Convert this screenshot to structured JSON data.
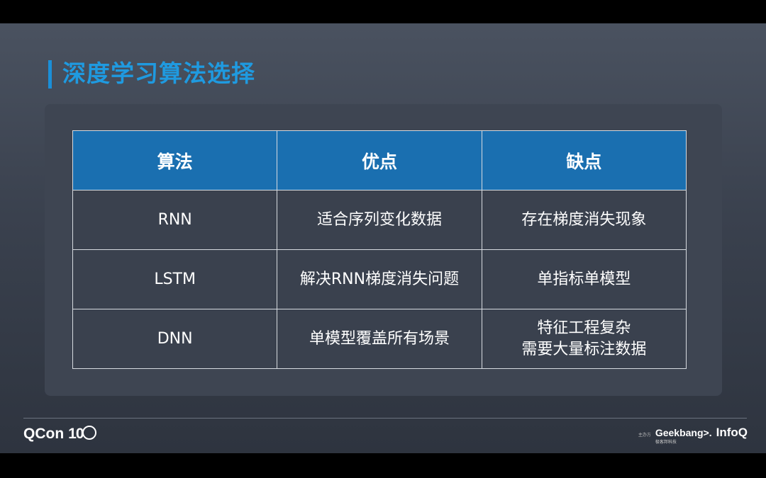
{
  "slide": {
    "title": "深度学习算法选择",
    "table": {
      "headers": [
        "算法",
        "优点",
        "缺点"
      ],
      "rows": [
        {
          "algo": "RNN",
          "pros": "适合序列变化数据",
          "cons": [
            "存在梯度消失现象"
          ]
        },
        {
          "algo": "LSTM",
          "pros": "解决RNN梯度消失问题",
          "cons": [
            "单指标单模型"
          ]
        },
        {
          "algo": "DNN",
          "pros": "单模型覆盖所有场景",
          "cons": [
            "特征工程复杂",
            "需要大量标注数据"
          ]
        }
      ]
    }
  },
  "footer": {
    "brand": "QCon",
    "brand_suffix": "10",
    "host_label": "主办方",
    "geekbang": "Geekbang>.",
    "geekbang_sub": "极客邦科技",
    "infoq": "InfoQ"
  },
  "colors": {
    "title": "#1f9ae0",
    "header_bg": "#1a6fb0",
    "cell_bg": "#3a414e"
  }
}
